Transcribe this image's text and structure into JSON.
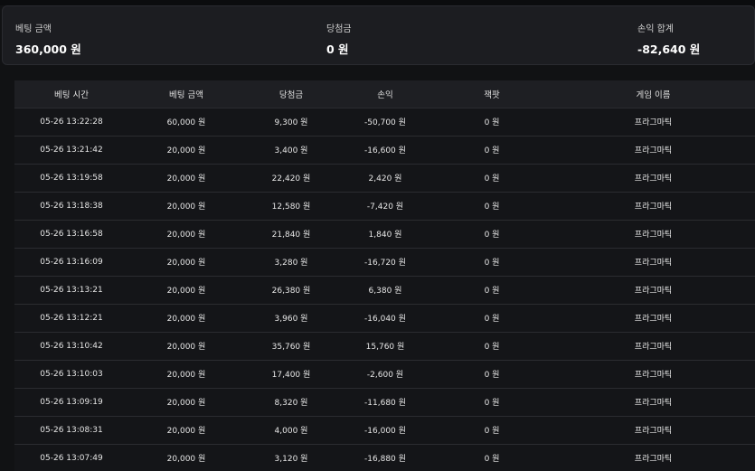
{
  "summary": {
    "bet": {
      "label": "베팅 금액",
      "value": "360,000 원"
    },
    "win": {
      "label": "당첨금",
      "value": "0 원"
    },
    "profit": {
      "label": "손익 합계",
      "value": "-82,640 원"
    }
  },
  "table": {
    "headers": [
      "베팅 시간",
      "베팅 금액",
      "당첨금",
      "손익",
      "잭팟",
      "게임 이름"
    ],
    "rows": [
      [
        "05-26 13:22:28",
        "60,000 원",
        "9,300 원",
        "-50,700 원",
        "0 원",
        "프라그마틱"
      ],
      [
        "05-26 13:21:42",
        "20,000 원",
        "3,400 원",
        "-16,600 원",
        "0 원",
        "프라그마틱"
      ],
      [
        "05-26 13:19:58",
        "20,000 원",
        "22,420 원",
        "2,420 원",
        "0 원",
        "프라그마틱"
      ],
      [
        "05-26 13:18:38",
        "20,000 원",
        "12,580 원",
        "-7,420 원",
        "0 원",
        "프라그마틱"
      ],
      [
        "05-26 13:16:58",
        "20,000 원",
        "21,840 원",
        "1,840 원",
        "0 원",
        "프라그마틱"
      ],
      [
        "05-26 13:16:09",
        "20,000 원",
        "3,280 원",
        "-16,720 원",
        "0 원",
        "프라그마틱"
      ],
      [
        "05-26 13:13:21",
        "20,000 원",
        "26,380 원",
        "6,380 원",
        "0 원",
        "프라그마틱"
      ],
      [
        "05-26 13:12:21",
        "20,000 원",
        "3,960 원",
        "-16,040 원",
        "0 원",
        "프라그마틱"
      ],
      [
        "05-26 13:10:42",
        "20,000 원",
        "35,760 원",
        "15,760 원",
        "0 원",
        "프라그마틱"
      ],
      [
        "05-26 13:10:03",
        "20,000 원",
        "17,400 원",
        "-2,600 원",
        "0 원",
        "프라그마틱"
      ],
      [
        "05-26 13:09:19",
        "20,000 원",
        "8,320 원",
        "-11,680 원",
        "0 원",
        "프라그마틱"
      ],
      [
        "05-26 13:08:31",
        "20,000 원",
        "4,000 원",
        "-16,000 원",
        "0 원",
        "프라그마틱"
      ],
      [
        "05-26 13:07:49",
        "20,000 원",
        "3,120 원",
        "-16,880 원",
        "0 원",
        "프라그마틱"
      ]
    ]
  }
}
